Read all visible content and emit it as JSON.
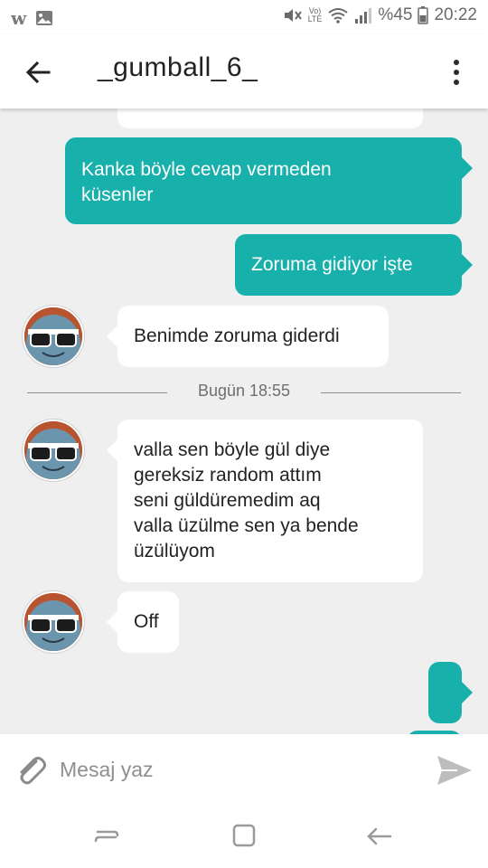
{
  "status_bar": {
    "battery_text": "%45",
    "time": "20:22",
    "lte_top": "Vo)",
    "lte_bottom": "LTE"
  },
  "header": {
    "title": "_gumball_6_"
  },
  "messages": {
    "m1": "Kanka böyle cevap vermeden\nküsenler",
    "m2": "Zoruma gidiyor işte",
    "m3": "Benimde zoruma giderdi",
    "m4": "valla sen böyle gül diye\ngereksiz random attım\nseni güldüremedim aq\nvalla üzülme sen ya bende\nüzülüyom",
    "m5": "Off"
  },
  "date_divider": "Bugün 18:55",
  "input": {
    "placeholder": "Mesaj yaz"
  },
  "colors": {
    "outgoing": "#17b0ab",
    "incoming": "#ffffff",
    "background": "#efefef"
  },
  "icons": [
    "wattpad-w-icon",
    "image-icon",
    "mute-icon",
    "wifi-icon",
    "signal-icon",
    "battery-icon",
    "back-arrow-icon",
    "more-vert-icon",
    "attach-icon",
    "send-icon",
    "recents-icon",
    "home-icon",
    "back-nav-icon"
  ]
}
